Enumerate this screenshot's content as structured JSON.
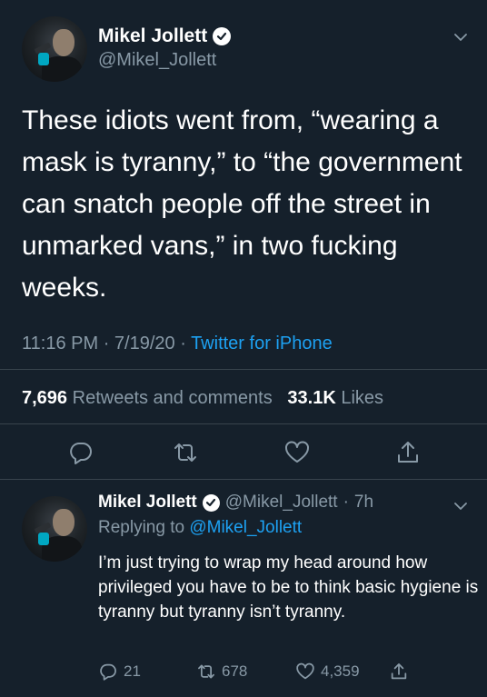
{
  "colors": {
    "background": "#15202b",
    "text_primary": "#ffffff",
    "text_secondary": "#8899a6",
    "link": "#1da1f2",
    "divider": "#38444d"
  },
  "main_tweet": {
    "author": {
      "display_name": "Mikel Jollett",
      "handle": "@Mikel_Jollett",
      "verified_icon": "verified-badge-icon",
      "avatar": "profile-photo"
    },
    "menu_icon": "chevron-down-icon",
    "text": "These idiots went from, “wearing a mask is tyranny,” to “the government can snatch people off the street in unmarked vans,” in two fucking weeks.",
    "time": "11:16 PM",
    "date": "7/19/20",
    "source": "Twitter for iPhone",
    "retweets_count": "7,696",
    "retweets_label": "Retweets and comments",
    "likes_count": "33.1K",
    "likes_label": "Likes",
    "actions": [
      "reply-icon",
      "retweet-icon",
      "like-icon",
      "share-icon"
    ]
  },
  "reply_tweet": {
    "author": {
      "display_name": "Mikel Jollett",
      "handle": "@Mikel_Jollett",
      "verified_icon": "verified-badge-icon",
      "avatar": "profile-photo"
    },
    "time_ago": "7h",
    "replying_label": "Replying to",
    "replying_to": "@Mikel_Jollett",
    "text": "I’m just trying to wrap my head around how privileged you have to be to think basic hygiene is tyranny but tyranny isn’t tyranny.",
    "reply_count": "21",
    "retweet_count": "678",
    "like_count": "4,359",
    "menu_icon": "chevron-down-icon"
  }
}
